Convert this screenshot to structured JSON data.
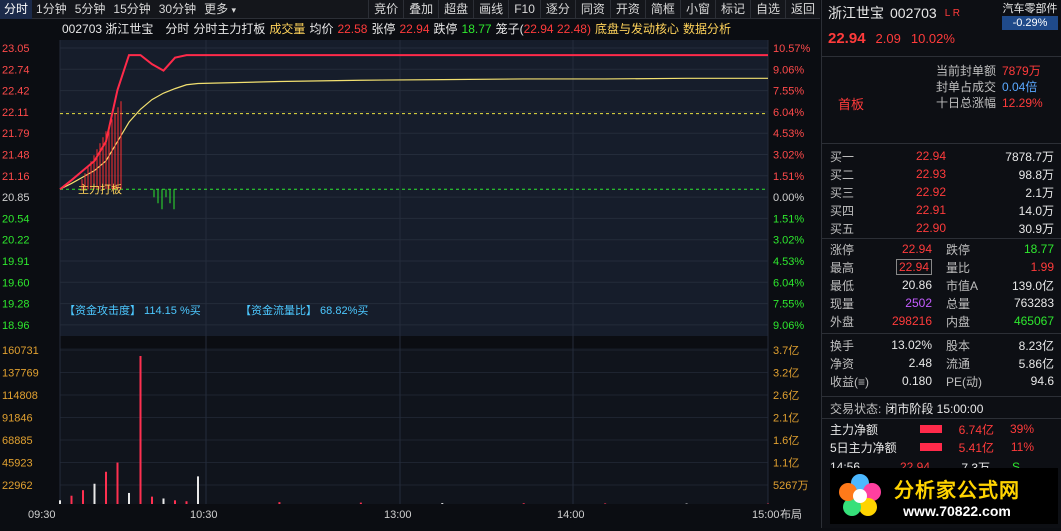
{
  "toolbar": {
    "left": [
      "分时",
      "1分钟",
      "5分钟",
      "15分钟",
      "30分钟",
      "更多"
    ],
    "right": [
      "竞价",
      "叠加",
      "超盘",
      "画线",
      "F10",
      "逐分",
      "同资",
      "开资",
      "简框",
      "小窗",
      "标记",
      "自选",
      "返回"
    ]
  },
  "infobar": {
    "code": "002703 浙江世宝",
    "t1": "分时",
    "t2": "分时主力打板",
    "t3": "成交量",
    "avg_label": "均价",
    "avg": "22.58",
    "zt_label": "张停",
    "zt": "22.94",
    "dt_label": "跌停",
    "dt": "18.77",
    "chip_label": "笼子(",
    "chip": "22.94 22.48)",
    "strategy": "底盘与发动核心",
    "strategy2": "数据分析"
  },
  "price_axis": [
    "23.05",
    "22.74",
    "22.42",
    "22.11",
    "21.79",
    "21.48",
    "21.16",
    "20.85",
    "20.54",
    "20.22",
    "19.91",
    "19.60",
    "19.28",
    "18.96"
  ],
  "pct_axis": [
    "10.57%",
    "9.06%",
    "7.55%",
    "6.04%",
    "4.53%",
    "3.02%",
    "1.51%",
    "0.00%",
    "1.51%",
    "3.02%",
    "4.53%",
    "6.04%",
    "7.55%",
    "9.06%"
  ],
  "vol_axis": [
    "160731",
    "137769",
    "114808",
    "91846",
    "68885",
    "45923",
    "22962"
  ],
  "amt_axis": [
    "3.7亿",
    "3.2亿",
    "2.6亿",
    "2.1亿",
    "1.6亿",
    "1.1亿",
    "5267万"
  ],
  "time_axis": [
    "09:30",
    "10:30",
    "13:00",
    "14:00",
    "15:00"
  ],
  "chart_labels": {
    "zlbd": "主力打板",
    "gjd_label": "【资金攻击度】",
    "gjd": "114.15 %买",
    "lll_label": "【资金流量比】",
    "lll": "68.82%买",
    "layout": "布局"
  },
  "chart_data": {
    "type": "line",
    "title": "",
    "x": [
      "09:30",
      "09:35",
      "09:40",
      "09:45",
      "09:50",
      "09:55",
      "10:00",
      "10:05",
      "10:10",
      "10:15",
      "10:20",
      "10:25",
      "10:30",
      "11:00",
      "11:30",
      "13:00",
      "13:30",
      "14:00",
      "14:30",
      "15:00"
    ],
    "series": [
      {
        "name": "",
        "values": [
          20.86,
          21.0,
          21.15,
          21.3,
          21.6,
          22.4,
          22.94,
          22.94,
          22.8,
          22.7,
          22.9,
          22.94,
          22.94,
          22.94,
          22.94,
          22.94,
          22.94,
          22.94,
          22.94,
          22.94
        ]
      },
      {
        "name": "均价",
        "values": [
          20.86,
          20.95,
          21.05,
          21.15,
          21.3,
          21.6,
          21.9,
          22.1,
          22.25,
          22.35,
          22.42,
          22.48,
          22.5,
          22.53,
          22.55,
          22.56,
          22.57,
          22.57,
          22.58,
          22.58
        ]
      }
    ],
    "ylim": [
      18.77,
      23.05
    ],
    "volume": [
      4000,
      9000,
      15000,
      22000,
      35000,
      45000,
      12000,
      160731,
      8000,
      6000,
      4000,
      3000,
      30000,
      2000,
      1500,
      1000,
      800,
      600,
      500,
      400
    ]
  },
  "stock": {
    "name": "浙江世宝",
    "code": "002703",
    "tag": "L R",
    "price": "22.94",
    "change": "2.09",
    "pct": "10.02%",
    "sector": "汽车零部件",
    "sector_pct": "-0.29%"
  },
  "seal": [
    {
      "label": "当前封单额",
      "value": "7879万"
    },
    {
      "label": "封单占成交",
      "value": "0.04倍"
    },
    {
      "label": "十日总涨幅",
      "value": "12.29%"
    }
  ],
  "board": "首板",
  "bids": [
    {
      "label": "买一",
      "price": "22.94",
      "vol": "7878.7万"
    },
    {
      "label": "买二",
      "price": "22.93",
      "vol": "98.8万"
    },
    {
      "label": "买三",
      "price": "22.92",
      "vol": "2.1万"
    },
    {
      "label": "买四",
      "price": "22.91",
      "vol": "14.0万"
    },
    {
      "label": "买五",
      "price": "22.90",
      "vol": "30.9万"
    }
  ],
  "stats": [
    {
      "l1": "涨停",
      "v1": "22.94",
      "l2": "跌停",
      "v2": "18.77"
    },
    {
      "l1": "最高",
      "v1": "22.94",
      "l2": "量比",
      "v2": "1.99"
    },
    {
      "l1": "最低",
      "v1": "20.86",
      "l2": "市值A",
      "v2": "139.0亿"
    },
    {
      "l1": "现量",
      "v1": "2502",
      "l2": "总量",
      "v2": "763283"
    },
    {
      "l1": "外盘",
      "v1": "298216",
      "l2": "内盘",
      "v2": "465067"
    }
  ],
  "fund": [
    {
      "l1": "换手",
      "v1": "13.02%",
      "l2": "股本",
      "v2": "8.23亿"
    },
    {
      "l1": "净资",
      "v1": "2.48",
      "l2": "流通",
      "v2": "5.86亿"
    },
    {
      "l1": "收益(≡)",
      "v1": "0.180",
      "l2": "PE(动)",
      "v2": "94.6"
    }
  ],
  "status": {
    "label": "交易状态:",
    "value": "闭市阶段 15:00:00"
  },
  "flow": [
    {
      "label": "主力净额",
      "amount": "6.74亿",
      "pct": "39%"
    },
    {
      "label": "5日主力净额",
      "amount": "5.41亿",
      "pct": "11%"
    }
  ],
  "tick": {
    "time": "14:56",
    "price": "22.94",
    "vol": "7.3万",
    "flag": "S"
  },
  "logo": {
    "text": "分析家公式网",
    "url": "www.70822.com"
  }
}
